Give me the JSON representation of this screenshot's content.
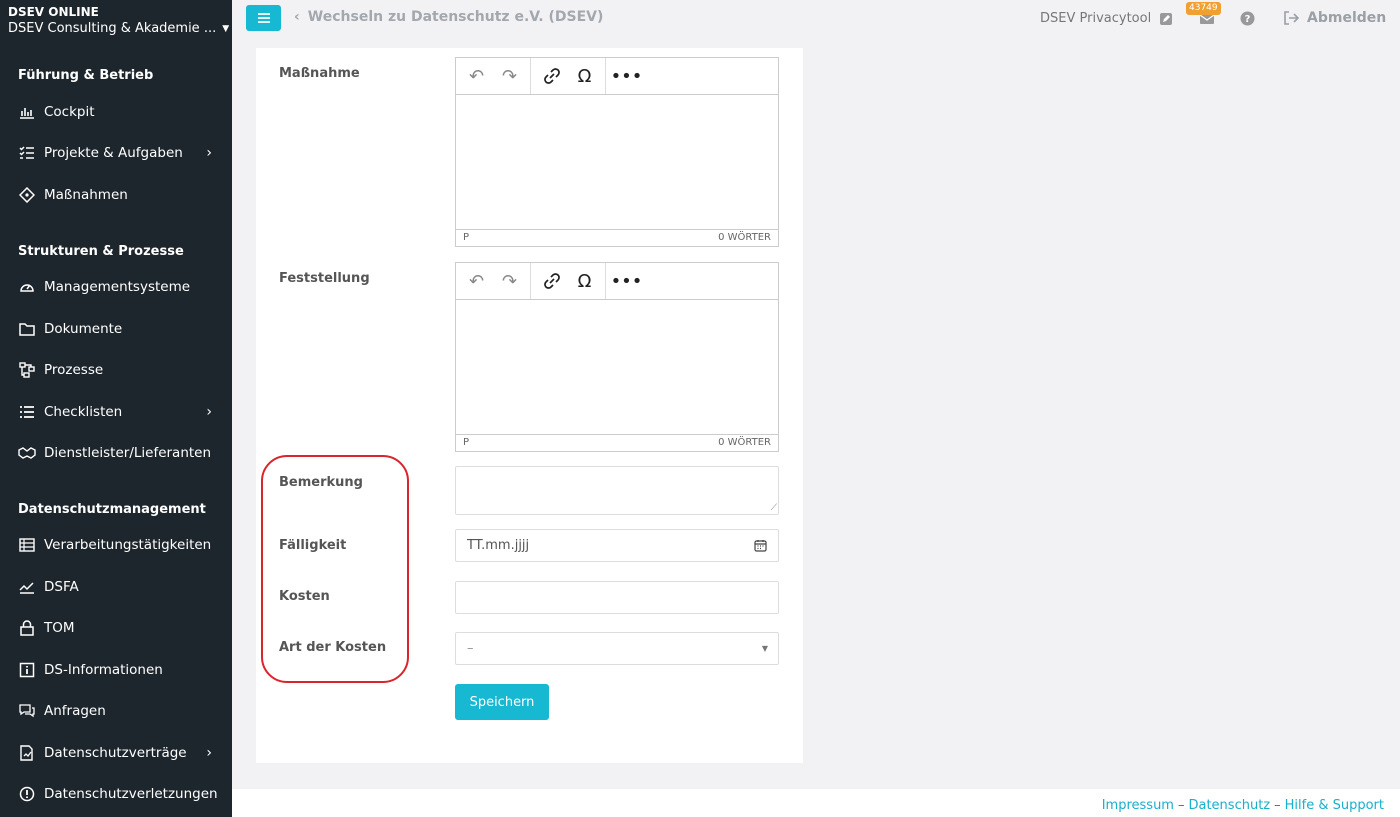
{
  "brand": {
    "title": "DSEV ONLINE",
    "org": "DSEV Consulting & Akademie ..."
  },
  "sidebar": {
    "sections": [
      {
        "title": "Führung & Betrieb"
      },
      {
        "title": "Strukturen & Prozesse"
      },
      {
        "title": "Datenschutzmanagement"
      }
    ],
    "items": [
      {
        "label": "Cockpit",
        "icon": "chart-icon"
      },
      {
        "label": "Projekte & Aufgaben",
        "icon": "checklist-icon"
      },
      {
        "label": "Maßnahmen",
        "icon": "diamond-icon"
      },
      {
        "label": "Managementsysteme",
        "icon": "gauge-icon"
      },
      {
        "label": "Dokumente",
        "icon": "folder-icon"
      },
      {
        "label": "Prozesse",
        "icon": "process-icon"
      },
      {
        "label": "Checklisten",
        "icon": "list-icon"
      },
      {
        "label": "Dienstleister/Lieferanten",
        "icon": "handshake-icon"
      },
      {
        "label": "Verarbeitungstätigkeiten",
        "icon": "table-icon"
      },
      {
        "label": "DSFA",
        "icon": "trend-icon"
      },
      {
        "label": "TOM",
        "icon": "lock-icon"
      },
      {
        "label": "DS-Informationen",
        "icon": "info-icon"
      },
      {
        "label": "Anfragen",
        "icon": "chat-icon"
      },
      {
        "label": "Datenschutzverträge",
        "icon": "contract-icon"
      },
      {
        "label": "Datenschutzverletzungen",
        "icon": "alert-icon"
      }
    ]
  },
  "topbar": {
    "back_label": "Wechseln zu Datenschutz e.V. (DSEV)",
    "app_name": "DSEV Privacytool",
    "mail_count": "43749",
    "logout_label": "Abmelden"
  },
  "form": {
    "massnahme_label": "Maßnahme",
    "feststellung_label": "Feststellung",
    "editor_path": "P",
    "editor_wordcount": "0 WÖRTER",
    "bemerkung_label": "Bemerkung",
    "faelligkeit_label": "Fälligkeit",
    "faelligkeit_placeholder": "TT.mm.jjjj",
    "kosten_label": "Kosten",
    "art_label": "Art der Kosten",
    "art_value": "–",
    "save_label": "Speichern"
  },
  "footer": {
    "impressum": "Impressum",
    "datenschutz": "Datenschutz",
    "hilfe": "Hilfe & Support",
    "sep": "–"
  },
  "colors": {
    "accent": "#17b8d1",
    "sidebar": "#1e262d",
    "highlight": "#d9252b",
    "badge": "#f0a030"
  }
}
